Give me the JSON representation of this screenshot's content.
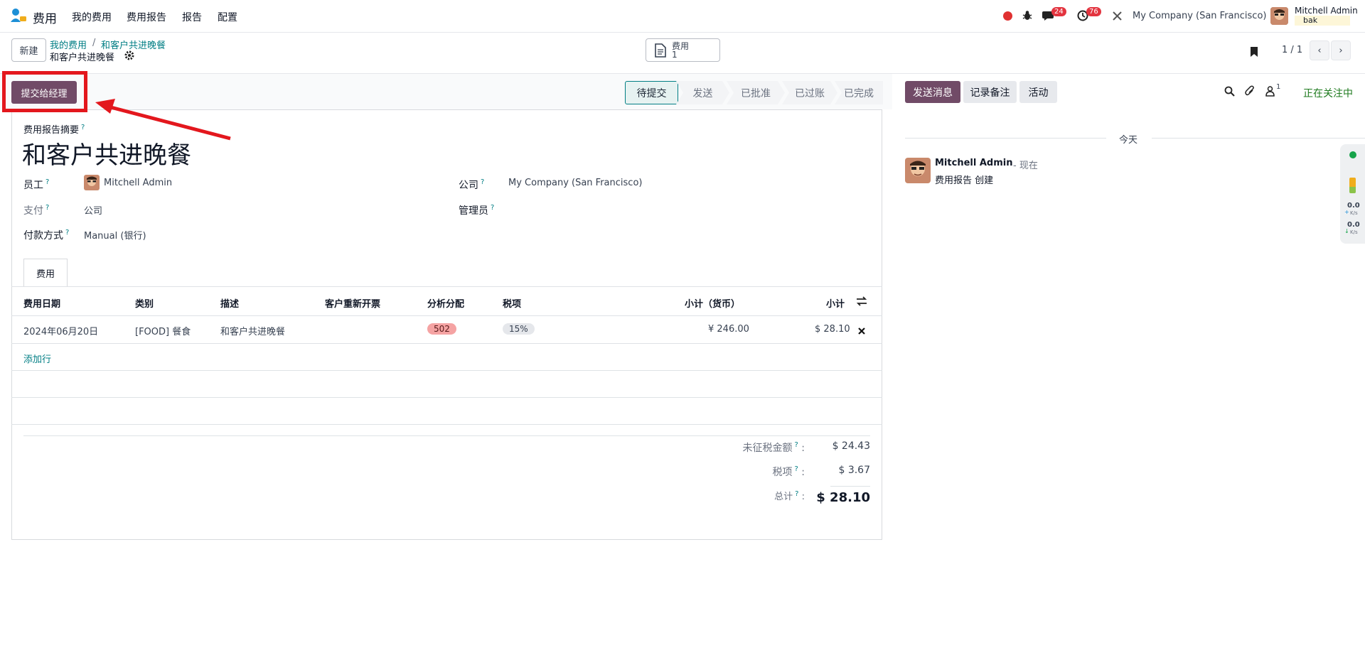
{
  "navbar": {
    "app_name": "费用",
    "menu": [
      "我的费用",
      "费用报告",
      "报告",
      "配置"
    ],
    "chat_badge": "24",
    "activity_badge": "76",
    "company": "My Company (San Francisco)",
    "user_name": "Mitchell Admin",
    "db_name": "bak"
  },
  "control": {
    "new_button": "新建",
    "breadcrumb": [
      "我的费用",
      "和客户共进晚餐"
    ],
    "record_name": "和客户共进晚餐",
    "smart_button_label": "费用",
    "smart_button_count": "1",
    "pager": "1 / 1"
  },
  "actions": {
    "submit_button": "提交给经理"
  },
  "statusbar": [
    "待提交",
    "发送",
    "已批准",
    "已过账",
    "已完成"
  ],
  "form": {
    "summary_label": "费用报告摘要",
    "title": "和客户共进晚餐",
    "employee_label": "员工",
    "employee_value": "Mitchell Admin",
    "paid_by_label": "支付",
    "paid_by_value": "公司",
    "payment_method_label": "付款方式",
    "payment_method_value": "Manual (银行)",
    "company_label": "公司",
    "company_value": "My Company (San Francisco)",
    "manager_label": "管理员"
  },
  "tabs": [
    "费用"
  ],
  "table": {
    "headers": [
      "费用日期",
      "类别",
      "描述",
      "客户重新开票",
      "分析分配",
      "税项",
      "小计（货币）",
      "小计"
    ],
    "rows": [
      {
        "date": "2024年06月20日",
        "category": "[FOOD] 餐食",
        "description": "和客户共进晚餐",
        "analytic": "502",
        "tax": "15%",
        "subtotal_currency": "¥ 246.00",
        "subtotal": "$ 28.10"
      }
    ],
    "add_line": "添加行"
  },
  "totals": {
    "untaxed_label": "未征税金额",
    "untaxed_value": "$ 24.43",
    "tax_label": "税项",
    "tax_value": "$ 3.67",
    "total_label": "总计",
    "total_value": "$ 28.10"
  },
  "chatter": {
    "send_message": "发送消息",
    "log_note": "记录备注",
    "activity": "活动",
    "follower_count": "1",
    "following": "正在关注中",
    "date_sep": "今天",
    "author": "Mitchell Admin",
    "time": "- 现在",
    "message": "费用报告 创建"
  },
  "side_widget": {
    "up": "0.0",
    "up_unit": "K/s",
    "down": "0.0",
    "down_unit": "K/s"
  },
  "colors": {
    "primary": "#714b67",
    "teal": "#017e84",
    "annotation": "#e3171d",
    "analytic_pill": "#f5a3a3",
    "tax_pill": "#e5e7eb"
  }
}
